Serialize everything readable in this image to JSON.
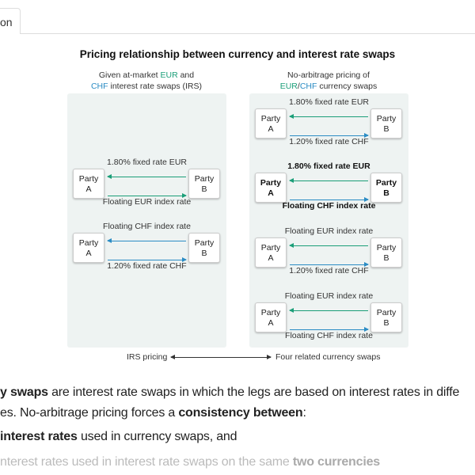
{
  "tab": {
    "label": "on"
  },
  "figure": {
    "title": "Pricing relationship between currency and interest rate swaps",
    "left_heading": {
      "pre": "Given at-market ",
      "eur": "EUR",
      "mid": " and",
      "chf": "CHF",
      "post": " interest rate swaps (IRS)"
    },
    "right_heading": {
      "line1": "No-arbitrage pricing of",
      "eur": "EUR",
      "slash": "/",
      "chf": "CHF",
      "post": " currency swaps"
    },
    "party_a": [
      "Party",
      "A"
    ],
    "party_b": [
      "Party",
      "B"
    ],
    "colors": {
      "eur": "#1a9e78",
      "chf": "#2b8cc4"
    },
    "left_swaps": [
      {
        "top": "1.80% fixed rate EUR",
        "bottom": "Floating EUR index rate",
        "top_color": "eur",
        "bottom_color": "eur"
      },
      {
        "top": "Floating CHF index rate",
        "bottom": "1.20% fixed rate CHF",
        "top_color": "chf",
        "bottom_color": "chf"
      }
    ],
    "right_swaps": [
      {
        "top": "1.80% fixed rate EUR",
        "bottom": "1.20% fixed rate CHF",
        "top_color": "eur",
        "bottom_color": "chf"
      },
      {
        "top": "1.80% fixed rate EUR",
        "bottom": "Floating CHF index rate",
        "top_color": "eur",
        "bottom_color": "chf",
        "bold": true
      },
      {
        "top": "Floating EUR index rate",
        "bottom": "1.20% fixed rate CHF",
        "top_color": "eur",
        "bottom_color": "chf"
      },
      {
        "top": "Floating EUR index rate",
        "bottom": "Floating CHF index rate",
        "top_color": "eur",
        "bottom_color": "chf"
      }
    ],
    "legend": {
      "left": "IRS pricing",
      "right": "Four related currency swaps"
    }
  },
  "body_text": {
    "line1": {
      "bold": "y swaps",
      "rest": " are interest rate swaps in which the legs are based on interest rates in diffe"
    },
    "line2": {
      "pre": "es. No-arbitrage pricing forces a ",
      "bold": "consistency between",
      "post": ":"
    },
    "line3": {
      "bold": "interest rates",
      "rest": " used in currency swaps, and"
    },
    "line4": {
      "pre": "nterest rates used in interest rate swaps on the same ",
      "bold": "two currencies"
    }
  }
}
